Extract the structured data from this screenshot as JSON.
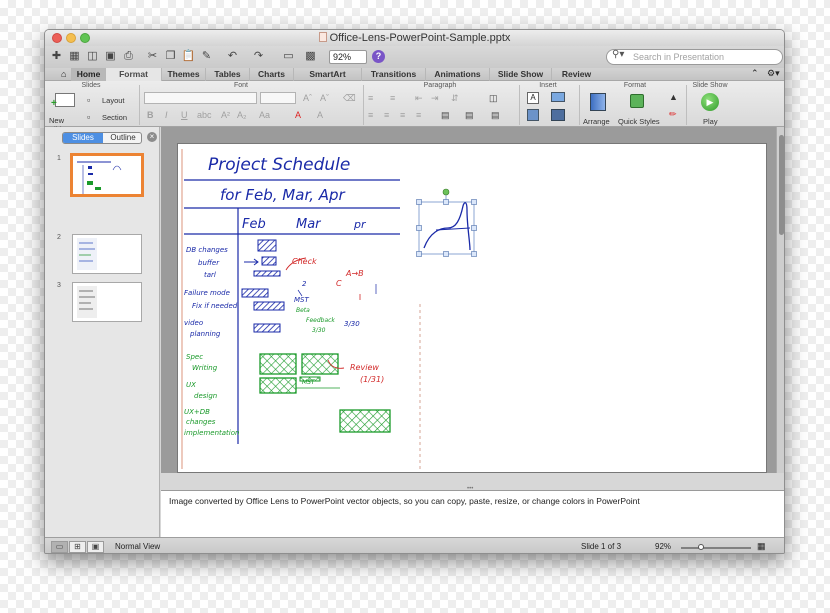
{
  "window": {
    "title": "Office-Lens-PowerPoint-Sample.pptx"
  },
  "toolbar": {
    "zoom_value": "92%",
    "help_label": "?",
    "search_placeholder": "Search in Presentation"
  },
  "tabs": [
    "Home",
    "Format",
    "Themes",
    "Tables",
    "Charts",
    "SmartArt",
    "Transitions",
    "Animations",
    "Slide Show",
    "Review"
  ],
  "ribbon": {
    "groups": {
      "slides": "Slides",
      "font": "Font",
      "paragraph": "Paragraph",
      "insert": "Insert",
      "format": "Format",
      "slideshow": "Slide Show"
    },
    "new_slide": "New Slide",
    "layout": "Layout",
    "section": "Section",
    "arrange": "Arrange",
    "quick_styles": "Quick Styles",
    "play": "Play"
  },
  "left_pane": {
    "tab_slides": "Slides",
    "tab_outline": "Outline",
    "slide_numbers": [
      "1",
      "2",
      "3"
    ]
  },
  "slide": {
    "title": "Project Schedule",
    "subtitle": "for   Feb, Mar, Apr",
    "months": [
      "Feb",
      "Mar",
      "pr"
    ],
    "tasks_blue": [
      "DB changes",
      "buffer",
      "tarl",
      "Failure mode",
      "Fix if needed",
      "video",
      "planning"
    ],
    "tasks_green": [
      "Spec",
      "Writing",
      "UX",
      "design",
      "UX+DB",
      "changes",
      "implementation"
    ],
    "annotations_red": [
      "Check",
      "A→B",
      "C",
      "Review",
      "(1/31)"
    ],
    "annotations_green": [
      "Review",
      "MST",
      "Beta",
      "3/30",
      "Feedback"
    ],
    "misc_blue": [
      "2",
      "3/30",
      "MST"
    ]
  },
  "notes": {
    "text": "Image converted by Office Lens to PowerPoint vector objects, so you can copy, paste, resize, or change colors in PowerPoint"
  },
  "status": {
    "view": "Normal View",
    "slide_of": "Slide 1 of 3",
    "zoom": "92%"
  },
  "colors": {
    "active_tab": "#4d8fe3",
    "thumb_selected": "#ec8333",
    "ink_blue": "#1a2aa8",
    "ink_green": "#1a9a2a",
    "ink_red": "#d22a2a"
  }
}
